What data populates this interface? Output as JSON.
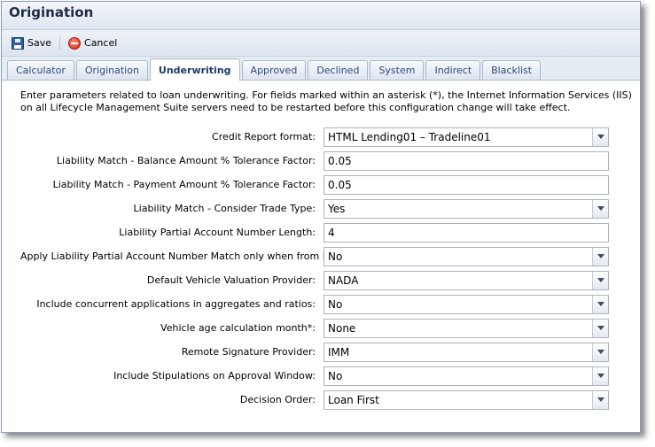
{
  "window": {
    "title": "Origination"
  },
  "toolbar": {
    "save_label": "Save",
    "cancel_label": "Cancel"
  },
  "tabs": [
    {
      "label": "Calculator",
      "active": false
    },
    {
      "label": "Origination",
      "active": false
    },
    {
      "label": "Underwriting",
      "active": true
    },
    {
      "label": "Approved",
      "active": false
    },
    {
      "label": "Declined",
      "active": false
    },
    {
      "label": "System",
      "active": false
    },
    {
      "label": "Indirect",
      "active": false
    },
    {
      "label": "Blacklist",
      "active": false
    }
  ],
  "description": "Enter parameters related to loan underwriting. For fields marked within an asterisk (*), the Internet Information Services (IIS) on all Lifecycle Management Suite servers need to be restarted before this configuration change will take effect.",
  "fields": [
    {
      "label": "Credit Report format:",
      "value": "HTML Lending01 – Tradeline01",
      "type": "select"
    },
    {
      "label": "Liability Match - Balance Amount % Tolerance Factor:",
      "value": "0.05",
      "type": "text"
    },
    {
      "label": "Liability Match - Payment Amount % Tolerance Factor:",
      "value": "0.05",
      "type": "text"
    },
    {
      "label": "Liability Match - Consider Trade Type:",
      "value": "Yes",
      "type": "select"
    },
    {
      "label": "Liability Partial Account Number Length:",
      "value": "4",
      "type": "text"
    },
    {
      "label": "Apply Liability Partial Account Number Match only when from Host:",
      "value": "No",
      "type": "select"
    },
    {
      "label": "Default Vehicle Valuation Provider:",
      "value": "NADA",
      "type": "select"
    },
    {
      "label": "Include concurrent applications in aggregates and ratios:",
      "value": "No",
      "type": "select"
    },
    {
      "label": "Vehicle age calculation month*:",
      "value": "None",
      "type": "select"
    },
    {
      "label": "Remote Signature Provider:",
      "value": "IMM",
      "type": "select"
    },
    {
      "label": "Include Stipulations on Approval Window:",
      "value": "No",
      "type": "select"
    },
    {
      "label": "Decision Order:",
      "value": "Loan First",
      "type": "select"
    }
  ]
}
